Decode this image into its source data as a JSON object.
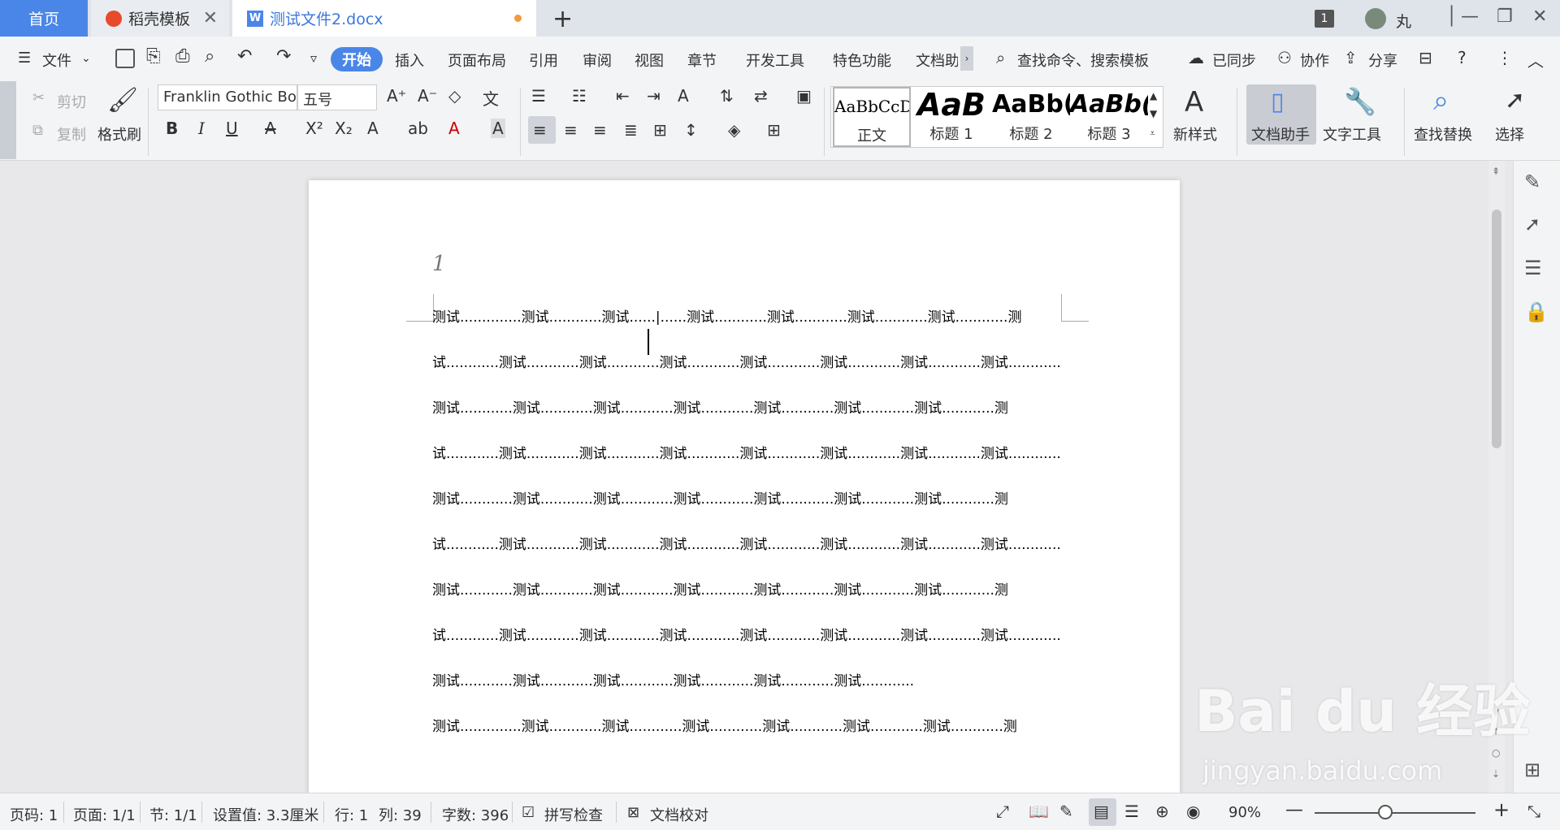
{
  "tabs": {
    "home": "首页",
    "templates": "稻壳模板",
    "document": "测试文件2.docx",
    "new_tab": "+"
  },
  "titlebar": {
    "window_badge": "1",
    "username": "丸"
  },
  "menu": {
    "file": "文件",
    "start": "开始",
    "insert": "插入",
    "page_layout": "页面布局",
    "references": "引用",
    "review": "审阅",
    "view": "视图",
    "chapter": "章节",
    "developer": "开发工具",
    "features": "特色功能",
    "doc_helper": "文档助",
    "search": "查找命令、搜索模板",
    "synced": "已同步",
    "collaborate": "协作",
    "share": "分享"
  },
  "ribbon": {
    "cut": "剪切",
    "copy": "复制",
    "format_painter": "格式刷",
    "font_name": "Franklin Gothic Bo",
    "font_size": "五号",
    "styles": [
      {
        "preview": "AaBbCcDd",
        "name": "正文"
      },
      {
        "preview": "AaB",
        "name": "标题 1"
      },
      {
        "preview": "AaBb(",
        "name": "标题 2"
      },
      {
        "preview": "AaBb(",
        "name": "标题 3"
      }
    ],
    "new_style": "新样式",
    "doc_assistant": "文档助手",
    "text_tools": "文字工具",
    "find_replace": "查找替换",
    "select": "选择"
  },
  "document": {
    "header_number": "1",
    "lines": [
      "测试..............测试............测试......|......测试............测试............测试............测试............测",
      "试............测试............测试............测试............测试............测试............测试............测试............",
      "测试............测试............测试............测试............测试............测试............测试............测",
      "试............测试............测试............测试............测试............测试............测试............测试............",
      "测试............测试............测试............测试............测试............测试............测试............测",
      "试............测试............测试............测试............测试............测试............测试............测试............",
      "测试............测试............测试............测试............测试............测试............测试............测",
      "试............测试............测试............测试............测试............测试............测试............测试............",
      "测试............测试............测试............测试............测试............测试............",
      "测试..............测试............测试............测试............测试............测试............测试............测"
    ]
  },
  "watermark": {
    "brand": "Bai du 经验",
    "url": "jingyan.baidu.com"
  },
  "statusbar": {
    "page_code": "页码: 1",
    "page": "页面: 1/1",
    "section": "节: 1/1",
    "setting": "设置值: 3.3厘米",
    "row": "行: 1",
    "col": "列: 39",
    "word_count": "字数: 396",
    "spell_check": "拼写检查",
    "doc_proof": "文档校对",
    "zoom": "90%"
  },
  "colors": {
    "accent": "#4a86e8",
    "unsaved_dot": "#f29b38"
  }
}
